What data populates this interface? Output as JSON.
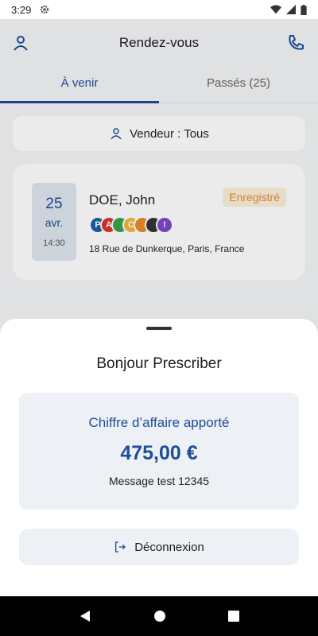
{
  "status_bar": {
    "time": "3:29"
  },
  "header": {
    "title": "Rendez-vous"
  },
  "tabs": [
    {
      "label": "À venir",
      "active": true
    },
    {
      "label": "Passés (25)",
      "active": false
    }
  ],
  "filter": {
    "label": "Vendeur : Tous"
  },
  "appointment": {
    "day": "25",
    "month": "avr.",
    "time": "14:30",
    "client": "DOE, John",
    "status": "Enregistré",
    "address": "18 Rue de Dunkerque, Paris, France",
    "tags": [
      {
        "letter": "P",
        "color": "#1f5fa8"
      },
      {
        "letter": "A",
        "color": "#d8352b"
      },
      {
        "letter": "",
        "color": "#3aa34a"
      },
      {
        "letter": "C",
        "color": "#f2b63a"
      },
      {
        "letter": "",
        "color": "#e88a2b"
      },
      {
        "letter": "",
        "color": "#333333"
      },
      {
        "letter": "!",
        "color": "#7d49c9"
      }
    ]
  },
  "sheet": {
    "greeting": "Bonjour Prescriber",
    "revenue_label": "Chiffre d’affaire apporté",
    "revenue_amount": "475,00 €",
    "message": "Message test 12345",
    "logout_label": "Déconnexion"
  },
  "colors": {
    "primary": "#1d4e9a",
    "status": "#e58f2b"
  }
}
